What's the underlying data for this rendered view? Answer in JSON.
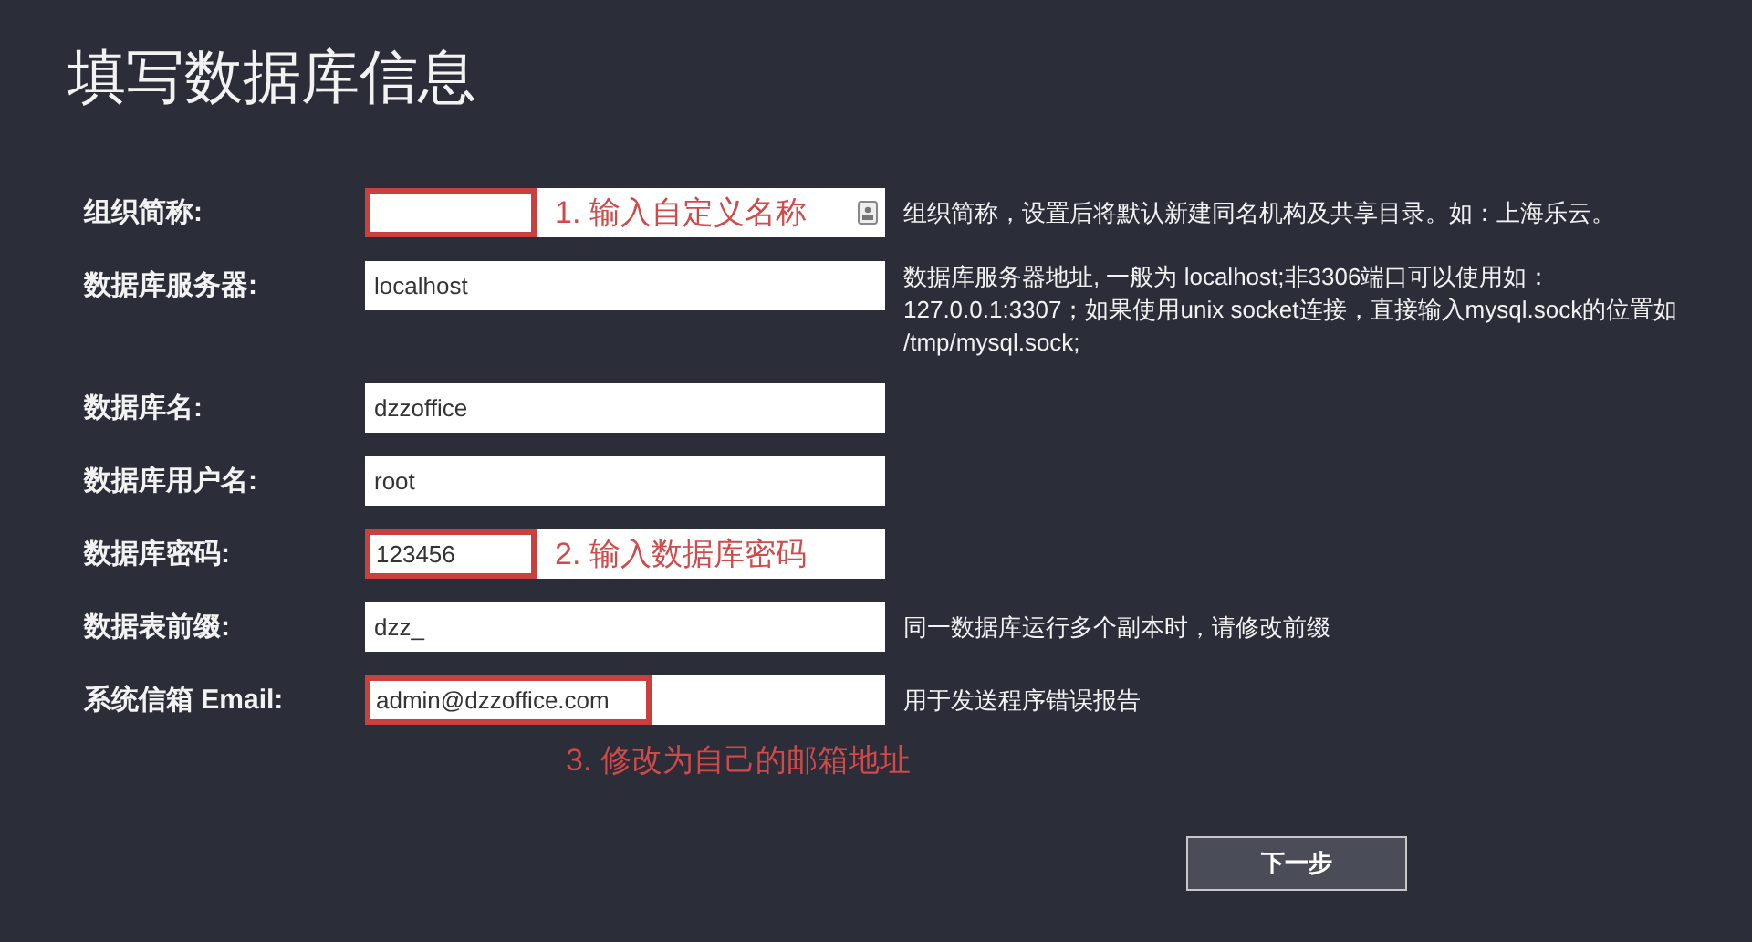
{
  "title": "填写数据库信息",
  "rows": [
    {
      "label": "组织简称:",
      "value": "",
      "highlighted": true,
      "annotation": "1. 输入自定义名称",
      "has_icon": true,
      "hint": "组织简称，设置后将默认新建同名机构及共享目录。如：上海乐云。"
    },
    {
      "label": "数据库服务器:",
      "value": "localhost",
      "highlighted": false,
      "has_icon": false,
      "hint": "数据库服务器地址, 一般为 localhost;非3306端口可以使用如：127.0.0.1:3307；如果使用unix socket连接，直接输入mysql.sock的位置如 /tmp/mysql.sock;"
    },
    {
      "label": "数据库名:",
      "value": "dzzoffice",
      "highlighted": false,
      "has_icon": false
    },
    {
      "label": "数据库用户名:",
      "value": "root",
      "highlighted": false,
      "has_icon": false
    },
    {
      "label": "数据库密码:",
      "value": "123456",
      "highlighted": true,
      "annotation": "2. 输入数据库密码",
      "has_icon": false
    },
    {
      "label": "数据表前缀:",
      "value": "dzz_",
      "highlighted": false,
      "has_icon": false,
      "hint": "同一数据库运行多个副本时，请修改前缀"
    },
    {
      "label": "系统信箱 Email:",
      "value": "admin@dzzoffice.com",
      "highlighted": true,
      "note_below": "3. 修改为自己的邮箱地址",
      "has_icon": false,
      "hint": "用于发送程序错误报告"
    }
  ],
  "next_button": "下一步"
}
